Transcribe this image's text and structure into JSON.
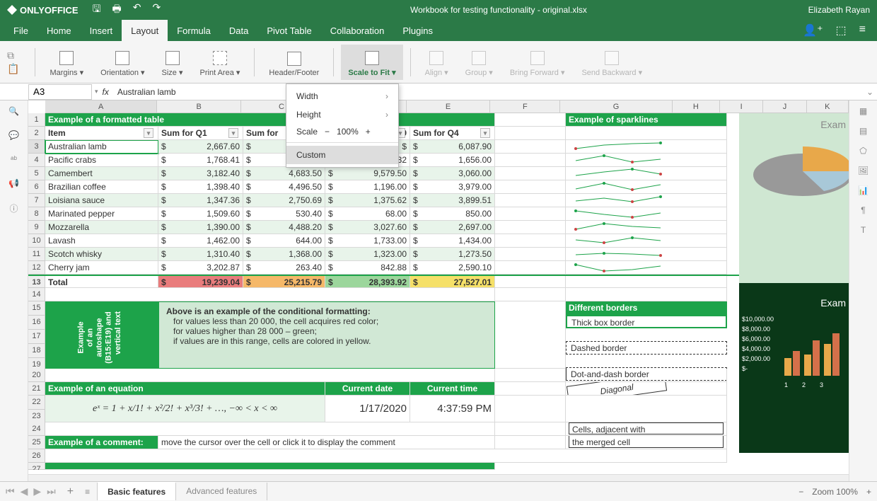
{
  "app": {
    "name": "ONLYOFFICE",
    "title": "Workbook for testing functionality - original.xlsx",
    "user": "Elizabeth Rayan"
  },
  "menu": {
    "tabs": [
      "File",
      "Home",
      "Insert",
      "Layout",
      "Formula",
      "Data",
      "Pivot Table",
      "Collaboration",
      "Plugins"
    ],
    "active": "Layout"
  },
  "ribbon": {
    "margins": "Margins",
    "orientation": "Orientation",
    "size": "Size",
    "print_area": "Print Area",
    "header_footer": "Header/Footer",
    "scale_to_fit": "Scale to Fit",
    "align": "Align",
    "group": "Group",
    "bring_forward": "Bring Forward",
    "send_backward": "Send Backward"
  },
  "dropdown": {
    "width": "Width",
    "height": "Height",
    "scale": "Scale",
    "scale_val": "100%",
    "custom": "Custom"
  },
  "formula": {
    "cell": "A3",
    "value": "Australian lamb"
  },
  "columns": [
    "A",
    "B",
    "C",
    "D",
    "E",
    "F",
    "G",
    "H",
    "I",
    "J",
    "K"
  ],
  "table": {
    "title": "Example of a formatted table",
    "sparklines_title": "Example of sparklines",
    "headers": {
      "item": "Item",
      "q1": "Sum for Q1",
      "q2": "Sum for",
      "q3_suffix": ".00",
      "q4": "Sum for Q4"
    },
    "rows": [
      {
        "item": "Australian lamb",
        "q1": "2,667.60",
        "q4": "6,087.90"
      },
      {
        "item": "Pacific crabs",
        "q1": "1,768.41",
        "q3s": ".32",
        "q4": "1,656.00"
      },
      {
        "item": "Camembert",
        "q1": "3,182.40",
        "q2": "4,683.50",
        "q3": "9,579.50",
        "q4": "3,060.00"
      },
      {
        "item": "Brazilian coffee",
        "q1": "1,398.40",
        "q2": "4,496.50",
        "q3": "1,196.00",
        "q4": "3,979.00"
      },
      {
        "item": "Loisiana sauce",
        "q1": "1,347.36",
        "q2": "2,750.69",
        "q3": "1,375.62",
        "q4": "3,899.51"
      },
      {
        "item": "Marinated pepper",
        "q1": "1,509.60",
        "q2": "530.40",
        "q3": "68.00",
        "q4": "850.00"
      },
      {
        "item": "Mozzarella",
        "q1": "1,390.00",
        "q2": "4,488.20",
        "q3": "3,027.60",
        "q4": "2,697.00"
      },
      {
        "item": "Lavash",
        "q1": "1,462.00",
        "q2": "644.00",
        "q3": "1,733.00",
        "q4": "1,434.00"
      },
      {
        "item": "Scotch whisky",
        "q1": "1,310.40",
        "q2": "1,368.00",
        "q3": "1,323.00",
        "q4": "1,273.50"
      },
      {
        "item": "Cherry jam",
        "q1": "3,202.87",
        "q2": "263.40",
        "q3": "842.88",
        "q4": "2,590.10"
      }
    ],
    "total": {
      "label": "Total",
      "q1": "19,239.04",
      "q2": "25,215.79",
      "q3": "28,393.92",
      "q4": "27,527.01"
    }
  },
  "info": {
    "vert1": "Example of an autoshape (B15:E19) and vertical text",
    "heading": "Above is an example of the conditional formatting:",
    "l1": "for values less than 20 000, the cell acquires red color;",
    "l2": "for values higher than 28 000 – green;",
    "l3": "if values are in this range, cells are colored in yellow."
  },
  "borders": {
    "title": "Different borders",
    "thick": "Thick box border",
    "dashed": "Dashed border",
    "dotdash": "Dot-and-dash border",
    "diagonal": "Diagonal",
    "merged1": "Cells, adjacent with",
    "merged2": "the merged cell"
  },
  "equation": {
    "title": "Example of an equation",
    "date_h": "Current date",
    "time_h": "Current time",
    "formula": "eˣ = 1 + x/1! + x²/2! + x³/3! + …,  −∞ < x < ∞",
    "date": "1/17/2020",
    "time": "4:37:59 PM"
  },
  "comment": {
    "title": "Example of a comment:",
    "text": "move the cursor over the cell or click it to display the comment"
  },
  "chart2": {
    "title": "Exam",
    "vals": [
      "$10,000.00",
      "$8,000.00",
      "$6,000.00",
      "$4,000.00",
      "$2,000.00",
      "$-"
    ],
    "x": [
      "1",
      "2",
      "3"
    ]
  },
  "chart1_label": "Exam",
  "sheets": {
    "s1": "Basic features",
    "s2": "Advanced features"
  },
  "zoom": "Zoom 100%"
}
